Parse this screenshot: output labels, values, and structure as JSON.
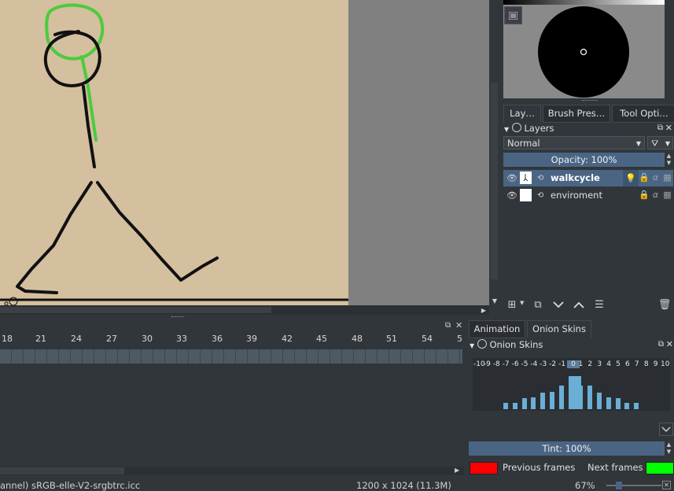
{
  "canvas": {
    "paper_color": "#d4bf9f",
    "canvas_bg": "#808080",
    "stroke_color": "#111111",
    "onion_color": "#4ccb3c"
  },
  "overview": {
    "menu_icon": "hamburger-menu-icon"
  },
  "dock_tabs": [
    {
      "label": "Lay…"
    },
    {
      "label": "Brush Pres…"
    },
    {
      "label": "Tool Opti…"
    }
  ],
  "layers": {
    "title": "Layers",
    "blend_mode": "Normal",
    "opacity_label": "Opacity:  100%",
    "items": [
      {
        "name": "walkcycle",
        "selected": true
      },
      {
        "name": "enviroment",
        "selected": false
      }
    ]
  },
  "bottom_tabs": [
    {
      "label": "Animation"
    },
    {
      "label": "Onion Skins"
    }
  ],
  "timeline": {
    "ticks": [
      "18",
      "21",
      "24",
      "27",
      "30",
      "33",
      "36",
      "39",
      "42",
      "45",
      "48",
      "51",
      "54",
      "5"
    ]
  },
  "onion_skins": {
    "title": "Onion Skins",
    "numbers": [
      "-10",
      "-9",
      "-8",
      "-7",
      "-6",
      "-5",
      "-4",
      "-3",
      "-2",
      "-1",
      "0",
      "1",
      "2",
      "3",
      "4",
      "5",
      "6",
      "7",
      "8",
      "9",
      "10"
    ],
    "levels": [
      0,
      0,
      0,
      0.18,
      0.2,
      0.34,
      0.36,
      0.5,
      0.52,
      0.72,
      1,
      0.72,
      0.72,
      0.5,
      0.36,
      0.34,
      0.2,
      0.18,
      0,
      0,
      0
    ],
    "tint_label": "Tint: 100%",
    "previous_label": "Previous frames",
    "next_label": "Next frames",
    "previous_color": "#ff0000",
    "next_color": "#00ff00"
  },
  "status": {
    "profile": "annel)  sRGB-elle-V2-srgbtrc.icc",
    "size": "1200 x 1024 (11.3M)",
    "zoom": "67%"
  }
}
